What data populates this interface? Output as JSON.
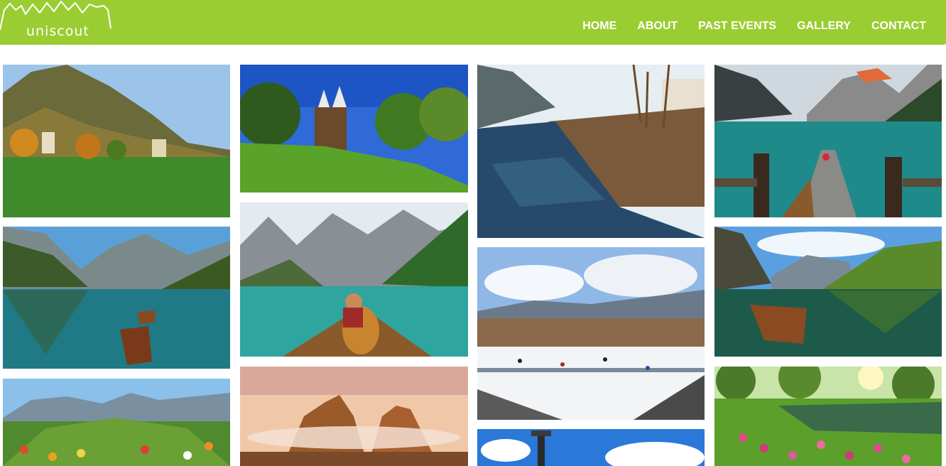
{
  "logo": {
    "text": "uniscout"
  },
  "nav": {
    "items": [
      "HOME",
      "ABOUT",
      "PAST EVENTS",
      "GALLERY",
      "CONTACT"
    ]
  },
  "colors": {
    "header_bg": "#9acd32",
    "nav_text": "#ffffff"
  },
  "gallery": {
    "photos": [
      "Valley meadow with autumn trees and mountain",
      "Castle among green trees on a grassy hill",
      "River flowing past bare trees and buildings",
      "Turquoise lake with wooden dock and rowboat",
      "Mountain lake reflection with rowboats",
      "Person with dog in a boat on a mountain lake",
      "Ice skating rink in a winter valley town",
      "Rowboat on a green mountain lake",
      "Flower garden with tulips and mountains",
      "Dolomite peaks in morning clouds",
      "Park pond with pink tulips and sunlight",
      "Street lamp against blue sky"
    ]
  }
}
